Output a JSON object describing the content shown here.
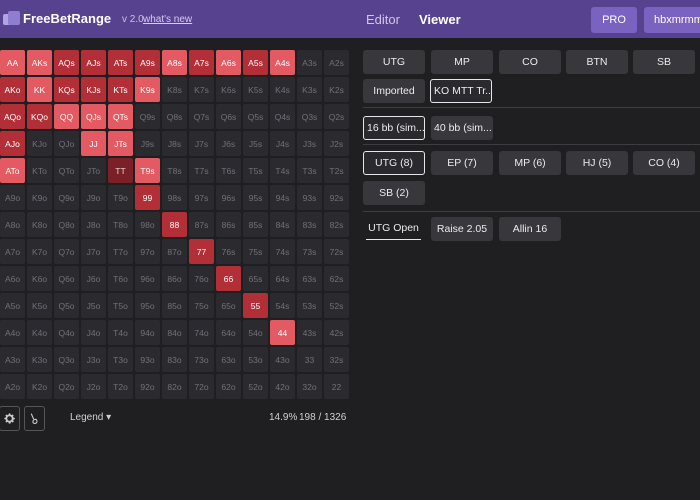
{
  "header": {
    "brand": "FreeBetRange",
    "version": "v 2.0",
    "whats_new": "what's new",
    "nav": [
      "Editor",
      "Viewer"
    ],
    "pro_label": "PRO",
    "user_label": "hbxmrmm"
  },
  "grid": {
    "ranks": [
      "A",
      "K",
      "Q",
      "J",
      "T",
      "9",
      "8",
      "7",
      "6",
      "5",
      "4",
      "3",
      "2"
    ],
    "highlighted": {
      "AA": 1,
      "AKs": 1,
      "AQs": 2,
      "AJs": 2,
      "ATs": 2,
      "A9s": 2,
      "A8s": 1,
      "A7s": 2,
      "A6s": 1,
      "A5s": 2,
      "A4s": 1,
      "AKo": 2,
      "KK": 1,
      "KQs": 2,
      "KJs": 2,
      "KTs": 2,
      "K9s": 1,
      "AQo": 2,
      "KQo": 2,
      "QQ": 1,
      "QJs": 1,
      "QTs": 1,
      "AJo": 2,
      "JJ": 1,
      "JTs": 1,
      "ATo": 1,
      "TT": 3,
      "T9s": 1,
      "99": 2,
      "88": 2,
      "77": 2,
      "66": 2,
      "55": 2,
      "44": 1
    }
  },
  "footer": {
    "legend_label": "Legend ▾",
    "percent": "14.9%",
    "combos": "198 / 1326"
  },
  "panel": {
    "positions": [
      "UTG",
      "MP",
      "CO",
      "BTN",
      "SB"
    ],
    "sources": [
      "Imported",
      "KO MTT Tr..."
    ],
    "stacks": [
      "16 bb (sim...",
      "40 bb (sim..."
    ],
    "spots": [
      "UTG (8)",
      "EP (7)",
      "MP (6)",
      "HJ (5)",
      "CO (4)",
      "SB (2)"
    ],
    "actions": [
      "UTG Open",
      "Raise 2.05",
      "Allin 16"
    ]
  },
  "colors": {
    "header_bg": "#57428f",
    "raise_strong": "#e35a62",
    "raise": "#b32f38",
    "raise_dark": "#7a2026",
    "cell_empty": "#2b2b2f",
    "bg": "#1f1f22"
  },
  "icons": [
    "logo-icon",
    "gear-icon",
    "brush-icon"
  ]
}
